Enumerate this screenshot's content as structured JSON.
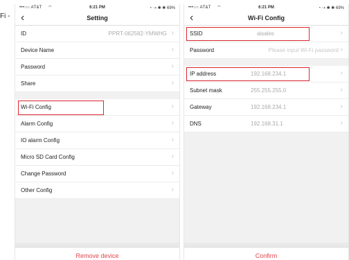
{
  "edge_text": "Fi -",
  "status_bar": {
    "carrier": "•••○○ AT&T",
    "wifi": "⌔",
    "time": "6:21 PM",
    "battery": "◔ ⇢ ✱ ✱ 69%"
  },
  "settings_screen": {
    "back": "‹",
    "title": "Setting",
    "rows_group1": [
      {
        "label": "ID",
        "value": "PPRT-062582-YMWHG"
      },
      {
        "label": "Device Name",
        "value": ""
      },
      {
        "label": "Password",
        "value": ""
      },
      {
        "label": "Share",
        "value": ""
      }
    ],
    "rows_group2": [
      {
        "label": "Wi-Fi Config",
        "value": ""
      },
      {
        "label": "Alarm Config",
        "value": ""
      },
      {
        "label": "IO alarm Config",
        "value": ""
      },
      {
        "label": "Micro SD Card Config",
        "value": ""
      },
      {
        "label": "Change Password",
        "value": ""
      },
      {
        "label": "Other Config",
        "value": ""
      }
    ],
    "bottom_button": "Remove device"
  },
  "wifi_screen": {
    "back": "‹",
    "title": "Wi-Fi Config",
    "ssid_label": "SSID",
    "ssid_value": "aisales",
    "password_label": "Password",
    "password_placeholder": "Please input Wi-Fi password",
    "ip_label": "IP address",
    "ip_value": "192.168.234.1",
    "subnet_label": "Subnet mask",
    "subnet_value": "255.255.255.0",
    "gateway_label": "Gateway",
    "gateway_value": "192.168.234.1",
    "dns_label": "DNS",
    "dns_value": "192.168.31.1",
    "bottom_button": "Confirm"
  },
  "chevron": "›",
  "highlight_color": "#d8262e"
}
